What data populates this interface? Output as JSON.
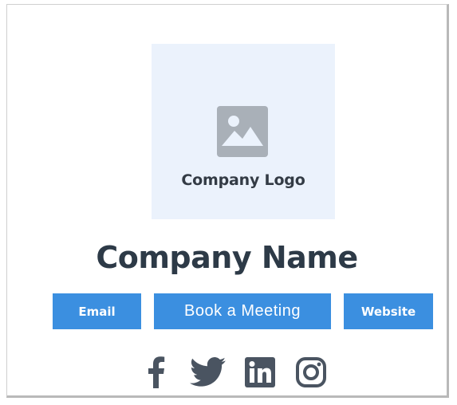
{
  "card": {
    "logo_placeholder_label": "Company Logo",
    "company_name": "Company Name",
    "buttons": {
      "email": "Email",
      "book_meeting": "Book a Meeting",
      "website": "Website"
    },
    "social_icons": [
      "facebook-icon",
      "twitter-icon",
      "linkedin-icon",
      "instagram-icon"
    ]
  },
  "colors": {
    "button_blue": "#3b8fe0",
    "logo_background": "#ebf2fc",
    "heading_text": "#2d3a47",
    "icon_gray": "#4a5461"
  }
}
